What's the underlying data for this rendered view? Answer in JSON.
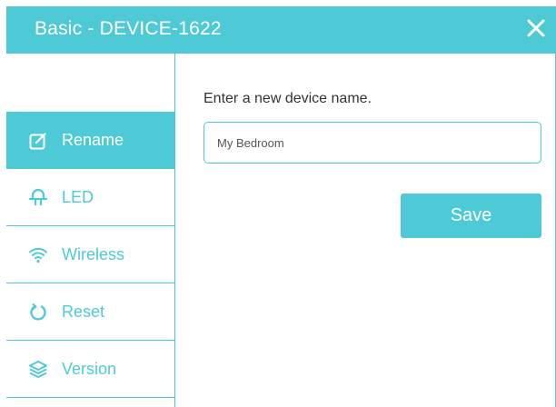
{
  "dialog": {
    "title": "Basic - DEVICE-1622",
    "close_icon": "close-icon"
  },
  "sidebar": {
    "items": [
      {
        "label": "Rename",
        "icon": "edit-icon",
        "active": true
      },
      {
        "label": "LED",
        "icon": "lightbulb-icon",
        "active": false
      },
      {
        "label": "Wireless",
        "icon": "wifi-icon",
        "active": false
      },
      {
        "label": "Reset",
        "icon": "reset-icon",
        "active": false
      },
      {
        "label": "Version",
        "icon": "layers-icon",
        "active": false
      }
    ]
  },
  "main": {
    "prompt": "Enter a new device name.",
    "device_name_value": "My Bedroom",
    "save_label": "Save"
  },
  "colors": {
    "accent": "#4ecad6",
    "text": "#333333",
    "background": "#ffffff"
  }
}
